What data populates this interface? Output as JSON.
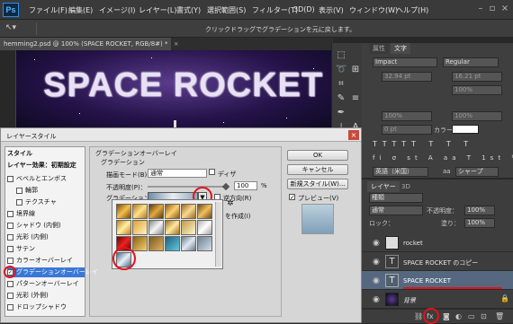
{
  "app": {
    "logo": "Ps"
  },
  "menubar": {
    "items": [
      "ファイル(F)",
      "編集(E)",
      "イメージ(I)",
      "レイヤー(L)",
      "書式(Y)",
      "選択範囲(S)",
      "フィルター(T)",
      "3D(D)",
      "表示(V)",
      "ウィンドウ(W)",
      "ヘルプ(H)"
    ]
  },
  "options": {
    "hint": "クリックドラッグでグラデーションを元に戻します。"
  },
  "document": {
    "tab": "hemming2.psd @ 100% (SPACE ROCKET, RGB/8#) *",
    "tab_close": "×",
    "canvas_text": "SPACE ROCKET"
  },
  "char_panel": {
    "tabs": [
      "属性",
      "文字"
    ],
    "font": "Impact",
    "style": "Regular",
    "size": "32.94 pt",
    "leading": "16.21 pt",
    "tracking": "100%",
    "scale_v": "100%",
    "scale_h": "100%",
    "baseline": "0 pt",
    "color_label": "カラー：",
    "language": "英語（米国）",
    "aa": "aa",
    "sharp": "シャープ"
  },
  "layers_panel": {
    "tabs": [
      "レイヤー",
      "3D"
    ],
    "filter": "種類",
    "blend": "通常",
    "opacity_label": "不透明度：",
    "opacity": "100%",
    "lock_label": "ロック：",
    "fill_label": "塗り：",
    "fill": "100%",
    "layers": [
      {
        "name": "rocket",
        "type": "image"
      },
      {
        "name": "SPACE ROCKET のコピー",
        "type": "text"
      },
      {
        "name": "SPACE ROCKET",
        "type": "text",
        "selected": true
      },
      {
        "name": "背景",
        "type": "background"
      }
    ]
  },
  "dialog": {
    "title": "レイヤースタイル",
    "close": "×",
    "style_header": "スタイル",
    "blend_header": "レイヤー効果：初期設定",
    "styles": [
      {
        "label": "ベベルとエンボス",
        "checked": false,
        "indent": false
      },
      {
        "label": "輪郭",
        "checked": false,
        "indent": true
      },
      {
        "label": "テクスチャ",
        "checked": false,
        "indent": true
      },
      {
        "label": "境界線",
        "checked": false,
        "indent": false
      },
      {
        "label": "シャドウ (内側)",
        "checked": false,
        "indent": false
      },
      {
        "label": "光彩 (内側)",
        "checked": false,
        "indent": false
      },
      {
        "label": "サテン",
        "checked": false,
        "indent": false
      },
      {
        "label": "カラーオーバーレイ",
        "checked": false,
        "indent": false
      },
      {
        "label": "グラデーションオーバーレイ",
        "checked": true,
        "indent": false,
        "active": true
      },
      {
        "label": "パターンオーバーレイ",
        "checked": false,
        "indent": false
      },
      {
        "label": "光彩 (外側)",
        "checked": false,
        "indent": false
      },
      {
        "label": "ドロップシャドウ",
        "checked": false,
        "indent": false
      }
    ],
    "group_title": "グラデーションオーバーレイ",
    "sub_title": "グラデーション",
    "blend_label": "描画モード(B)：",
    "blend_value": "通常",
    "dither": "ディザ",
    "opacity_label": "不透明度(P)：",
    "opacity_value": "100",
    "pct": "%",
    "gradient_label": "グラデーション：",
    "reverse": "逆方向(R)",
    "align_fragment": "を作成(I)",
    "buttons": {
      "ok": "OK",
      "cancel": "キャンセル",
      "new_style": "新規スタイル(W)...",
      "preview": "プレビュー(V)"
    }
  },
  "picker": {
    "gear": "✲"
  },
  "accent": "#e0131b"
}
